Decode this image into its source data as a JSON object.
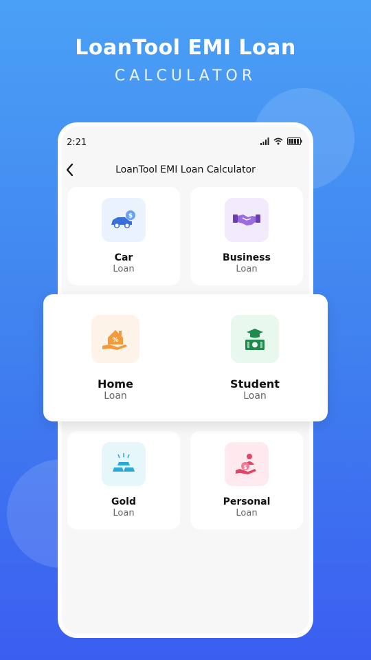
{
  "hero": {
    "title": "LoanTool EMI Loan",
    "subtitle": "CALCULATOR"
  },
  "status_bar": {
    "time": "2:21"
  },
  "app_bar": {
    "title": "LoanTool EMI Loan Calculator"
  },
  "colors": {
    "car_tile": "#eaf2fd",
    "business_tile": "#f1ebfb",
    "home_tile": "#fdf3e8",
    "student_tile": "#e9f8ee",
    "gold_tile": "#e6f7fb",
    "personal_tile": "#fde9ee"
  },
  "loans": [
    {
      "name": "Car",
      "sub": "Loan",
      "icon": "car-dollar-icon"
    },
    {
      "name": "Business",
      "sub": "Loan",
      "icon": "handshake-icon"
    },
    {
      "name": "Home",
      "sub": "Loan",
      "icon": "house-hand-icon"
    },
    {
      "name": "Student",
      "sub": "Loan",
      "icon": "graduation-cap-money-icon"
    },
    {
      "name": "Gold",
      "sub": "Loan",
      "icon": "gold-bars-icon"
    },
    {
      "name": "Personal",
      "sub": "Loan",
      "icon": "person-money-icon"
    }
  ]
}
